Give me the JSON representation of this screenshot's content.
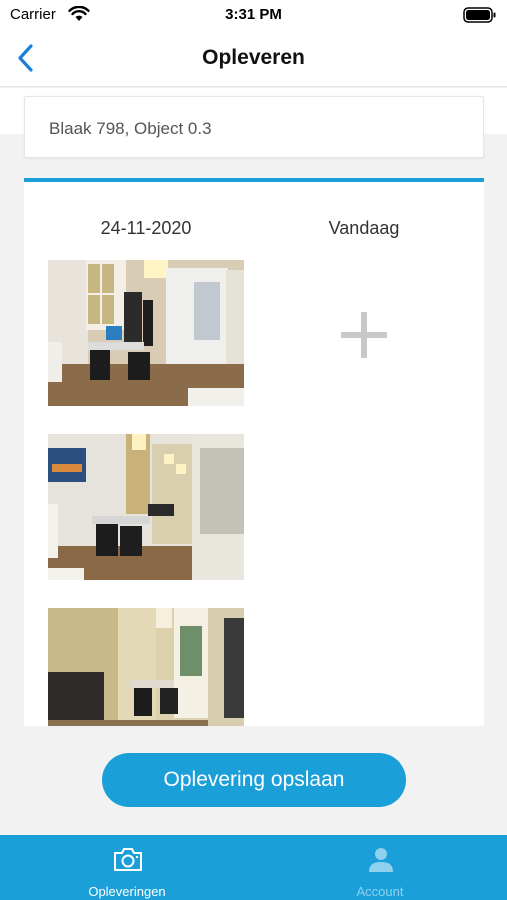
{
  "status_bar": {
    "carrier": "Carrier",
    "time": "3:31 PM"
  },
  "nav": {
    "title": "Opleveren",
    "back_icon": "chevron-left-icon"
  },
  "address": {
    "text": "Blaak 798, Object 0.3"
  },
  "comparison": {
    "left_header": "24-11-2020",
    "right_header": "Vandaag",
    "add_icon": "plus-icon",
    "photos": [
      {
        "label": "office-photo-1"
      },
      {
        "label": "office-photo-2"
      },
      {
        "label": "office-photo-3"
      }
    ]
  },
  "actions": {
    "save_label": "Oplevering opslaan"
  },
  "tabbar": {
    "items": [
      {
        "label": "Opleveringen",
        "icon": "camera-icon",
        "active": true
      },
      {
        "label": "Account",
        "icon": "person-icon",
        "active": false
      }
    ]
  },
  "colors": {
    "accent": "#1a9fd9",
    "background": "#f2f2f2",
    "back_chevron": "#1a7fd9"
  }
}
